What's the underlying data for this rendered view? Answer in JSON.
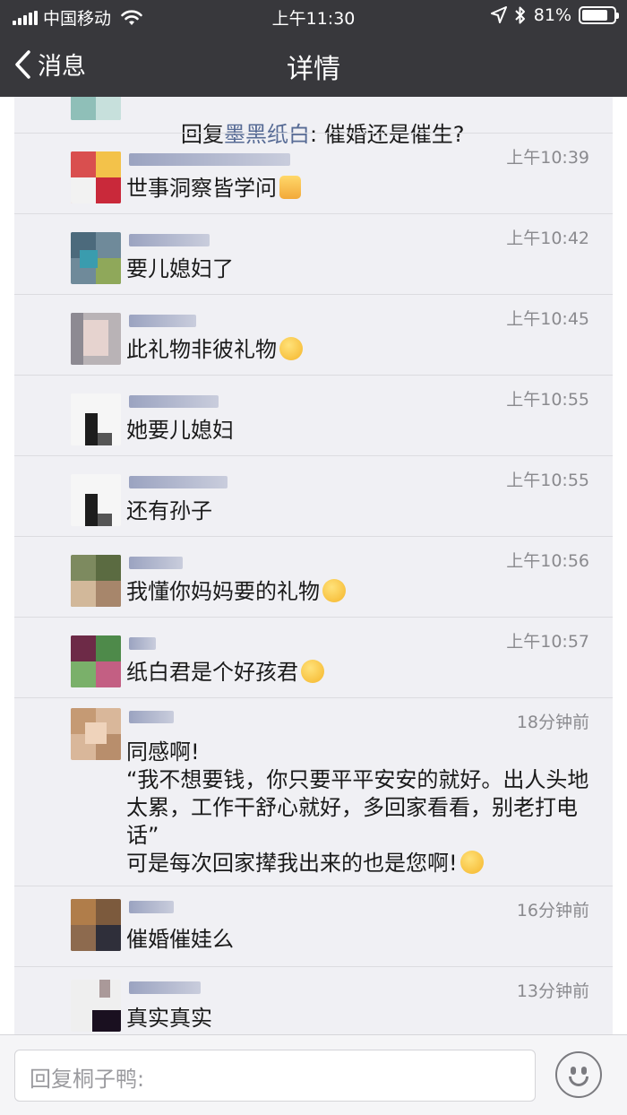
{
  "status_bar": {
    "carrier": "中国移动",
    "time": "上午11:30",
    "battery": "81%",
    "battery_level": 0.81
  },
  "nav": {
    "back_label": "消息",
    "title": "详情"
  },
  "reply": {
    "prefix": "回复",
    "name": "墨黑纸白",
    "text": ": 催婚还是催生?"
  },
  "comments": [
    {
      "time": "上午10:39",
      "text": "世事洞察皆学问",
      "emoji": "thumbs-up"
    },
    {
      "time": "上午10:42",
      "text": "要儿媳妇了"
    },
    {
      "time": "上午10:45",
      "text": "此礼物非彼礼物",
      "emoji": "thinking"
    },
    {
      "time": "上午10:55",
      "text": "她要儿媳妇"
    },
    {
      "time": "上午10:55",
      "text": "还有孙子"
    },
    {
      "time": "上午10:56",
      "text": "我懂你妈妈要的礼物",
      "emoji": "thinking"
    },
    {
      "time": "上午10:57",
      "text": "纸白君是个好孩君",
      "emoji": "giggle"
    },
    {
      "time": "18分钟前",
      "text": "同感啊!\n“我不想要钱，你只要平平安安的就好。出人头地太累，工作干舒心就好，多回家看看，别老打电话”\n可是每次回家撵我出来的也是您啊!",
      "emoji": "laugh-cry"
    },
    {
      "time": "16分钟前",
      "text": "催婚催娃么"
    },
    {
      "time": "13分钟前",
      "text": "真实真实"
    }
  ],
  "input": {
    "placeholder": "回复桐子鸭:"
  }
}
